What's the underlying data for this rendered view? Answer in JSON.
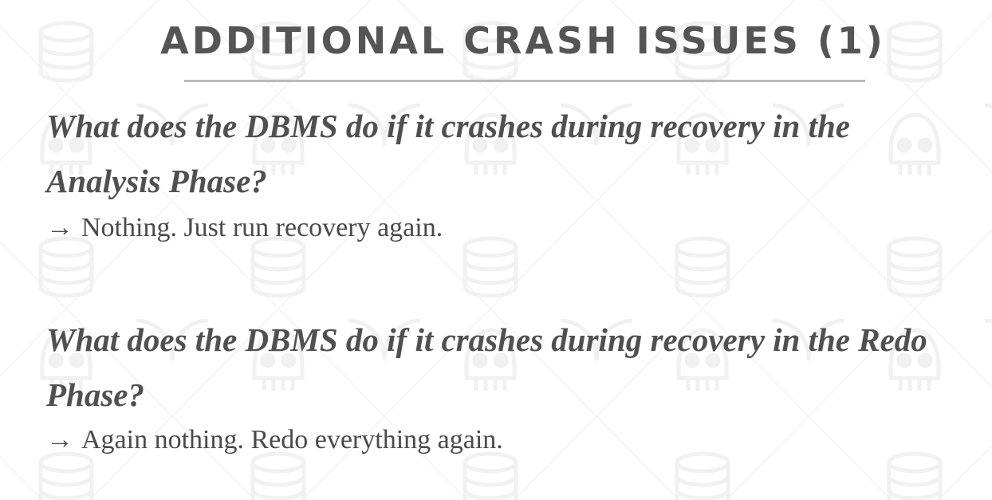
{
  "slide": {
    "title": "ADDITIONAL CRASH ISSUES (1)",
    "items": [
      {
        "question": "What does the DBMS do if it crashes during recovery in the Analysis Phase?",
        "arrow": "→",
        "answer": "Nothing. Just run recovery again."
      },
      {
        "question": "What does the DBMS do if it crashes during recovery in the Redo Phase?",
        "arrow": "→",
        "answer": "Again nothing. Redo everything again."
      }
    ]
  },
  "colors": {
    "text": "#4d4d4d",
    "title": "#555555",
    "rule": "#bbbbbb",
    "pattern": "#f3f3f3"
  },
  "icons": [
    "database-icon",
    "skull-icon"
  ]
}
